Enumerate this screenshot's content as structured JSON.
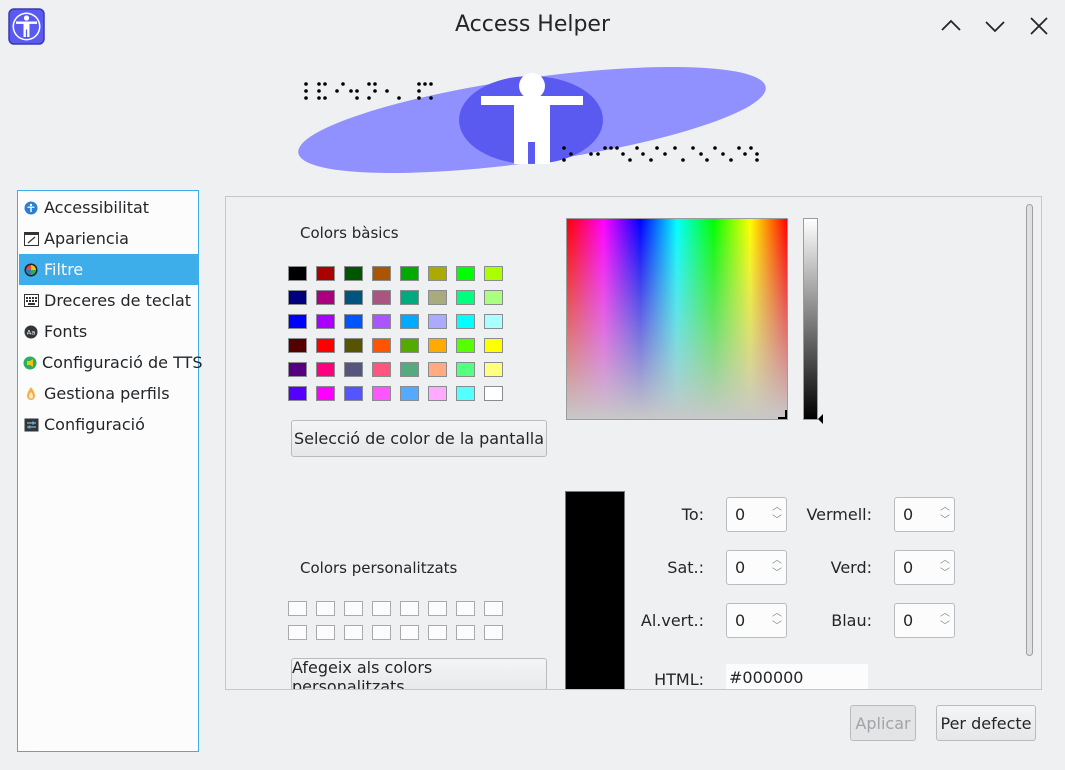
{
  "window": {
    "title": "Access Helper"
  },
  "sidebar": {
    "items": [
      {
        "label": "Accessibilitat",
        "icon": "accessibility-icon",
        "active": false
      },
      {
        "label": "Apariencia",
        "icon": "appearance-icon",
        "active": false
      },
      {
        "label": "Filtre",
        "icon": "filter-icon",
        "active": true
      },
      {
        "label": "Dreceres de teclat",
        "icon": "keyboard-icon",
        "active": false
      },
      {
        "label": "Fonts",
        "icon": "fonts-icon",
        "active": false
      },
      {
        "label": "Configuració de TTS",
        "icon": "tts-icon",
        "active": false
      },
      {
        "label": "Gestiona perfils",
        "icon": "profiles-icon",
        "active": false
      },
      {
        "label": "Configuració",
        "icon": "settings-icon",
        "active": false
      }
    ]
  },
  "color_dialog": {
    "basic_colors_label": "Colors bàsics",
    "basic_colors": [
      "#000000",
      "#aa0000",
      "#005500",
      "#aa5500",
      "#00aa00",
      "#aaaa00",
      "#00ff00",
      "#aaff00",
      "#00007f",
      "#aa007f",
      "#00557f",
      "#aa557f",
      "#00aa7f",
      "#aaaa7f",
      "#00ff7f",
      "#aaff7f",
      "#0000ff",
      "#aa00ff",
      "#0055ff",
      "#aa55ff",
      "#00aaff",
      "#aaaaff",
      "#00ffff",
      "#aaffff",
      "#550000",
      "#ff0000",
      "#555500",
      "#ff5500",
      "#55aa00",
      "#ffaa00",
      "#55ff00",
      "#ffff00",
      "#55007f",
      "#ff007f",
      "#55557f",
      "#ff557f",
      "#55aa7f",
      "#ffaa7f",
      "#55ff7f",
      "#ffff7f",
      "#5500ff",
      "#ff00ff",
      "#5555ff",
      "#ff55ff",
      "#55aaff",
      "#ffaaff",
      "#55ffff",
      "#ffffff"
    ],
    "pick_screen_button": "Selecció de color de la pantalla",
    "custom_colors_label": "Colors personalitzats",
    "add_custom_button": "Afegeix als colors personalitzats",
    "fields": {
      "hue_label": "To:",
      "hue_value": "0",
      "sat_label": "Sat.:",
      "sat_value": "0",
      "val_label": "Al.vert.:",
      "val_value": "0",
      "red_label": "Vermell:",
      "red_value": "0",
      "green_label": "Verd:",
      "green_value": "0",
      "blue_label": "Blau:",
      "blue_value": "0",
      "html_label": "HTML:",
      "html_value": "#000000"
    },
    "current_color": "#000000"
  },
  "footer": {
    "apply_button": "Aplicar",
    "defaults_button": "Per defecte"
  },
  "colors": {
    "accent": "#3daee9",
    "banner": "#9090ff",
    "banner_circle": "#5a5af0"
  }
}
